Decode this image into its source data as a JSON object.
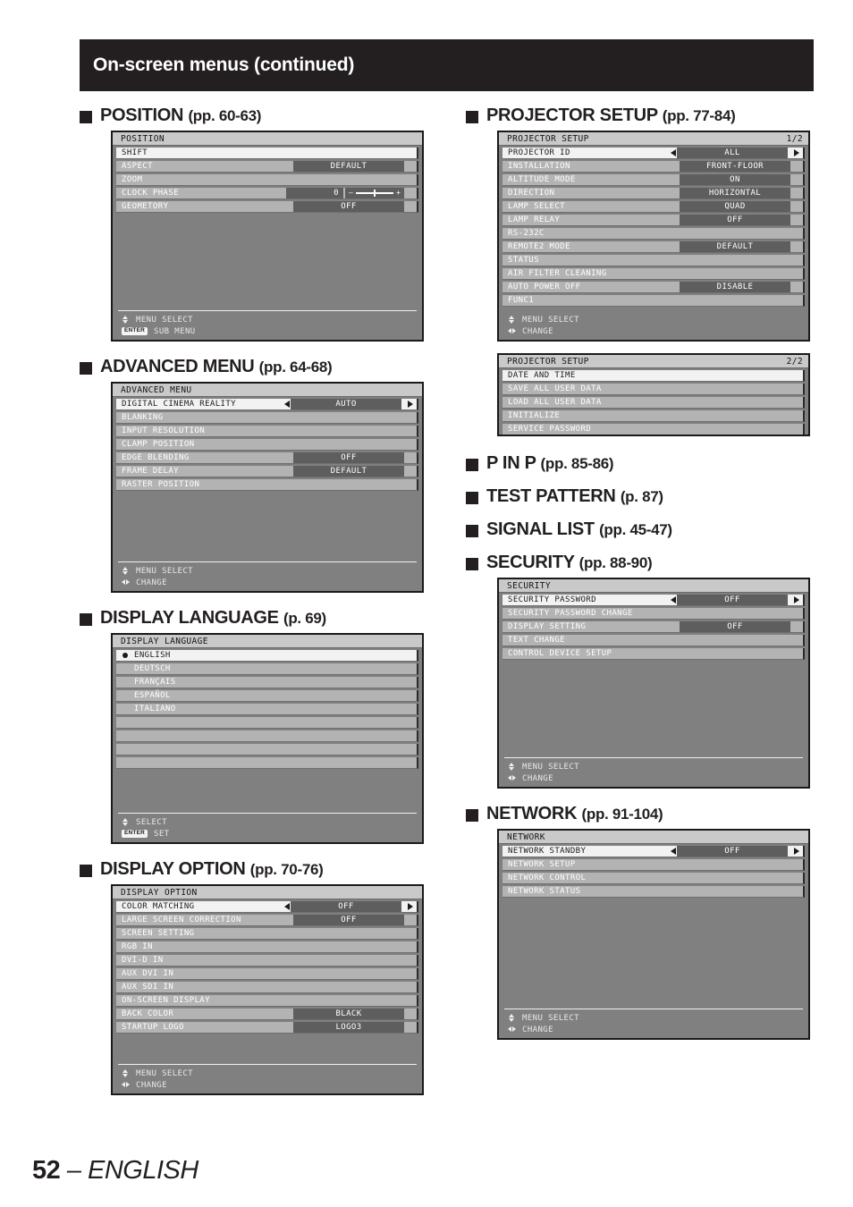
{
  "header": {
    "title": "On-screen menus (continued)"
  },
  "footer": {
    "page_number": "52",
    "separator": " – ",
    "language": "ENGLISH"
  },
  "sections": {
    "position": {
      "heading": "POSITION",
      "heading_pages": "(pp. 60-63)",
      "panel_title": "POSITION",
      "rows": [
        {
          "label": "SHIFT",
          "value": "",
          "selected": true
        },
        {
          "label": "ASPECT",
          "value": "DEFAULT"
        },
        {
          "label": "ZOOM",
          "value": ""
        },
        {
          "label": "CLOCK PHASE",
          "value": "0",
          "slider": true,
          "slider_minus": "–",
          "slider_plus": "+"
        },
        {
          "label": "GEOMETORY",
          "value": "OFF"
        }
      ],
      "help": [
        {
          "icon": "up-down-arrow-icon",
          "text": "MENU SELECT"
        },
        {
          "icon": "enter-key-icon",
          "key": "ENTER",
          "text": "SUB MENU"
        }
      ]
    },
    "advanced_menu": {
      "heading": "ADVANCED MENU",
      "heading_pages": "(pp. 64-68)",
      "panel_title": "ADVANCED MENU",
      "rows": [
        {
          "label": "DIGITAL CINEMA REALITY",
          "value": "AUTO",
          "selected": true,
          "arrows": true
        },
        {
          "label": "BLANKING",
          "value": ""
        },
        {
          "label": "INPUT RESOLUTION",
          "value": ""
        },
        {
          "label": "CLAMP POSITION",
          "value": ""
        },
        {
          "label": "EDGE BLENDING",
          "value": "OFF"
        },
        {
          "label": "FRAME DELAY",
          "value": "DEFAULT"
        },
        {
          "label": "RASTER POSITION",
          "value": ""
        }
      ],
      "help": [
        {
          "icon": "up-down-arrow-icon",
          "text": "MENU SELECT"
        },
        {
          "icon": "left-right-arrow-icon",
          "text": "CHANGE"
        }
      ]
    },
    "display_language": {
      "heading": "DISPLAY LANGUAGE",
      "heading_pages": "(p. 69)",
      "panel_title": "DISPLAY LANGUAGE",
      "rows": [
        {
          "label": "ENGLISH",
          "value": "",
          "selected": true,
          "radio": true
        },
        {
          "label": "DEUTSCH",
          "value": ""
        },
        {
          "label": "FRANÇAIS",
          "value": ""
        },
        {
          "label": "ESPAÑOL",
          "value": ""
        },
        {
          "label": "ITALIANO",
          "value": ""
        },
        {
          "label": "",
          "value": "",
          "blank": true
        },
        {
          "label": "",
          "value": "",
          "blank": true
        },
        {
          "label": "",
          "value": "",
          "blank": true
        },
        {
          "label": "",
          "value": "",
          "blank": true
        }
      ],
      "help": [
        {
          "icon": "up-down-arrow-icon",
          "text": "SELECT"
        },
        {
          "icon": "enter-key-icon",
          "key": "ENTER",
          "text": "SET"
        }
      ]
    },
    "display_option": {
      "heading": "DISPLAY OPTION",
      "heading_pages": "(pp. 70-76)",
      "panel_title": "DISPLAY OPTION",
      "rows": [
        {
          "label": "COLOR MATCHING",
          "value": "OFF",
          "selected": true,
          "arrows": true
        },
        {
          "label": "LARGE SCREEN CORRECTION",
          "value": "OFF"
        },
        {
          "label": "SCREEN SETTING",
          "value": ""
        },
        {
          "label": "RGB IN",
          "value": ""
        },
        {
          "label": "DVI-D IN",
          "value": ""
        },
        {
          "label": "AUX DVI IN",
          "value": ""
        },
        {
          "label": "AUX SDI IN",
          "value": ""
        },
        {
          "label": "ON-SCREEN DISPLAY",
          "value": ""
        },
        {
          "label": "BACK COLOR",
          "value": "BLACK"
        },
        {
          "label": "STARTUP LOGO",
          "value": "LOGO3"
        }
      ],
      "help": [
        {
          "icon": "up-down-arrow-icon",
          "text": "MENU SELECT"
        },
        {
          "icon": "left-right-arrow-icon",
          "text": "CHANGE"
        }
      ]
    },
    "projector_setup": {
      "heading": "PROJECTOR SETUP",
      "heading_pages": "(pp. 77-84)",
      "panel1_title": "PROJECTOR SETUP",
      "panel1_page": "1/2",
      "panel1_rows": [
        {
          "label": "PROJECTOR ID",
          "value": "ALL",
          "selected": true,
          "arrows": true
        },
        {
          "label": "INSTALLATION",
          "value": "FRONT-FLOOR"
        },
        {
          "label": "ALTITUDE MODE",
          "value": "ON"
        },
        {
          "label": "DIRECTION",
          "value": "HORIZONTAL"
        },
        {
          "label": "LAMP SELECT",
          "value": "QUAD"
        },
        {
          "label": "LAMP RELAY",
          "value": "OFF"
        },
        {
          "label": "RS-232C",
          "value": ""
        },
        {
          "label": "REMOTE2 MODE",
          "value": "DEFAULT"
        },
        {
          "label": "STATUS",
          "value": ""
        },
        {
          "label": "AIR FILTER CLEANING",
          "value": ""
        },
        {
          "label": "AUTO POWER OFF",
          "value": "DISABLE"
        },
        {
          "label": "FUNC1",
          "value": ""
        }
      ],
      "panel1_help": [
        {
          "icon": "up-down-arrow-icon",
          "text": "MENU SELECT"
        },
        {
          "icon": "left-right-arrow-icon",
          "text": "CHANGE"
        }
      ],
      "panel2_title": "PROJECTOR SETUP",
      "panel2_page": "2/2",
      "panel2_rows": [
        {
          "label": "DATE AND TIME",
          "value": "",
          "selected": true
        },
        {
          "label": "SAVE ALL USER DATA",
          "value": ""
        },
        {
          "label": "LOAD ALL USER DATA",
          "value": ""
        },
        {
          "label": "INITIALIZE",
          "value": ""
        },
        {
          "label": "SERVICE PASSWORD",
          "value": ""
        }
      ]
    },
    "p_in_p": {
      "heading": "P IN P",
      "heading_pages": "(pp. 85-86)"
    },
    "test_pattern": {
      "heading": "TEST PATTERN",
      "heading_pages": "(p. 87)"
    },
    "signal_list": {
      "heading": "SIGNAL LIST",
      "heading_pages": "(pp. 45-47)"
    },
    "security": {
      "heading": "SECURITY",
      "heading_pages": "(pp. 88-90)",
      "panel_title": "SECURITY",
      "rows": [
        {
          "label": "SECURITY PASSWORD",
          "value": "OFF",
          "selected": true,
          "arrows": true
        },
        {
          "label": "SECURITY PASSWORD CHANGE",
          "value": ""
        },
        {
          "label": "DISPLAY SETTING",
          "value": "OFF"
        },
        {
          "label": "TEXT CHANGE",
          "value": ""
        },
        {
          "label": "CONTROL DEVICE SETUP",
          "value": ""
        }
      ],
      "help": [
        {
          "icon": "up-down-arrow-icon",
          "text": "MENU SELECT"
        },
        {
          "icon": "left-right-arrow-icon",
          "text": "CHANGE"
        }
      ]
    },
    "network": {
      "heading": "NETWORK",
      "heading_pages": "(pp. 91-104)",
      "panel_title": "NETWORK",
      "rows": [
        {
          "label": "NETWORK STANDBY",
          "value": "OFF",
          "selected": true,
          "arrows": true
        },
        {
          "label": "NETWORK SETUP",
          "value": ""
        },
        {
          "label": "NETWORK CONTROL",
          "value": ""
        },
        {
          "label": "NETWORK STATUS",
          "value": ""
        }
      ],
      "help": [
        {
          "icon": "up-down-arrow-icon",
          "text": "MENU SELECT"
        },
        {
          "icon": "left-right-arrow-icon",
          "text": "CHANGE"
        }
      ]
    }
  },
  "colors": {
    "header_bg": "#231f20",
    "panel_bg": "#808080",
    "row_bg": "#b3b3b3",
    "row_selected_bg": "#f2f2f2",
    "value_bg": "#5e5e5e",
    "title_bg": "#c9c9c9"
  }
}
